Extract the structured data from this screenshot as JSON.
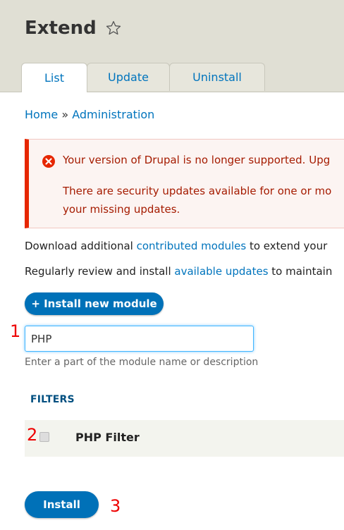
{
  "header": {
    "title": "Extend",
    "tabs": [
      {
        "label": "List",
        "active": true
      },
      {
        "label": "Update",
        "active": false
      },
      {
        "label": "Uninstall",
        "active": false
      }
    ]
  },
  "breadcrumb": {
    "home": "Home",
    "separator": "»",
    "admin": "Administration"
  },
  "messages": {
    "line1": "Your version of Drupal is no longer supported. Upg",
    "line2a": "There are security updates available for one or mo",
    "line2b": "your missing updates."
  },
  "intro": {
    "line1_pre": "Download additional ",
    "line1_link": "contributed modules",
    "line1_post": " to extend your",
    "line2_pre": "Regularly review and install ",
    "line2_link": "available updates",
    "line2_post": " to maintain"
  },
  "buttons": {
    "install_new_module": "+ Install new module",
    "install": "Install"
  },
  "filter": {
    "value": "PHP",
    "hint": "Enter a part of the module name or description"
  },
  "filters_heading": "FILTERS",
  "module": {
    "name": "PHP Filter"
  },
  "annotations": {
    "a1": "1",
    "a2": "2",
    "a3": "3"
  },
  "colors": {
    "accent": "#0071b8",
    "link": "#0074bd",
    "error": "#e62600",
    "annotation": "#ee0000"
  }
}
